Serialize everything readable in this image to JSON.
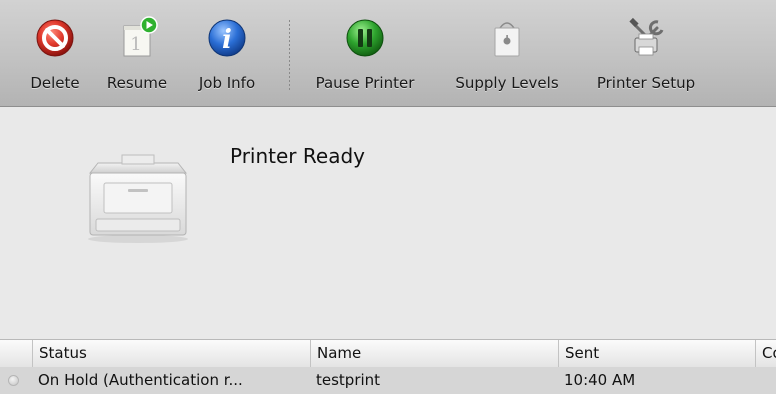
{
  "toolbar": {
    "items": [
      {
        "label": "Delete",
        "icon": "delete-icon"
      },
      {
        "label": "Resume",
        "icon": "resume-icon"
      },
      {
        "label": "Job Info",
        "icon": "info-icon"
      },
      {
        "label": "Pause Printer",
        "icon": "pause-icon"
      },
      {
        "label": "Supply Levels",
        "icon": "supply-bag-icon"
      },
      {
        "label": "Printer Setup",
        "icon": "printer-setup-icon"
      }
    ],
    "resume_badge": "1"
  },
  "status": {
    "text": "Printer Ready",
    "icon": "printer-icon"
  },
  "table": {
    "columns": [
      "Status",
      "Name",
      "Sent",
      "Co"
    ],
    "rows": [
      {
        "status": "On Hold (Authentication r...",
        "name": "testprint",
        "sent": "10:40 AM",
        "completed": ""
      }
    ]
  },
  "colors": {
    "delete_red": "#d9342b",
    "pause_green": "#2ea42e",
    "info_blue": "#2b6fd6",
    "row_selected": "#d6d6d6"
  }
}
